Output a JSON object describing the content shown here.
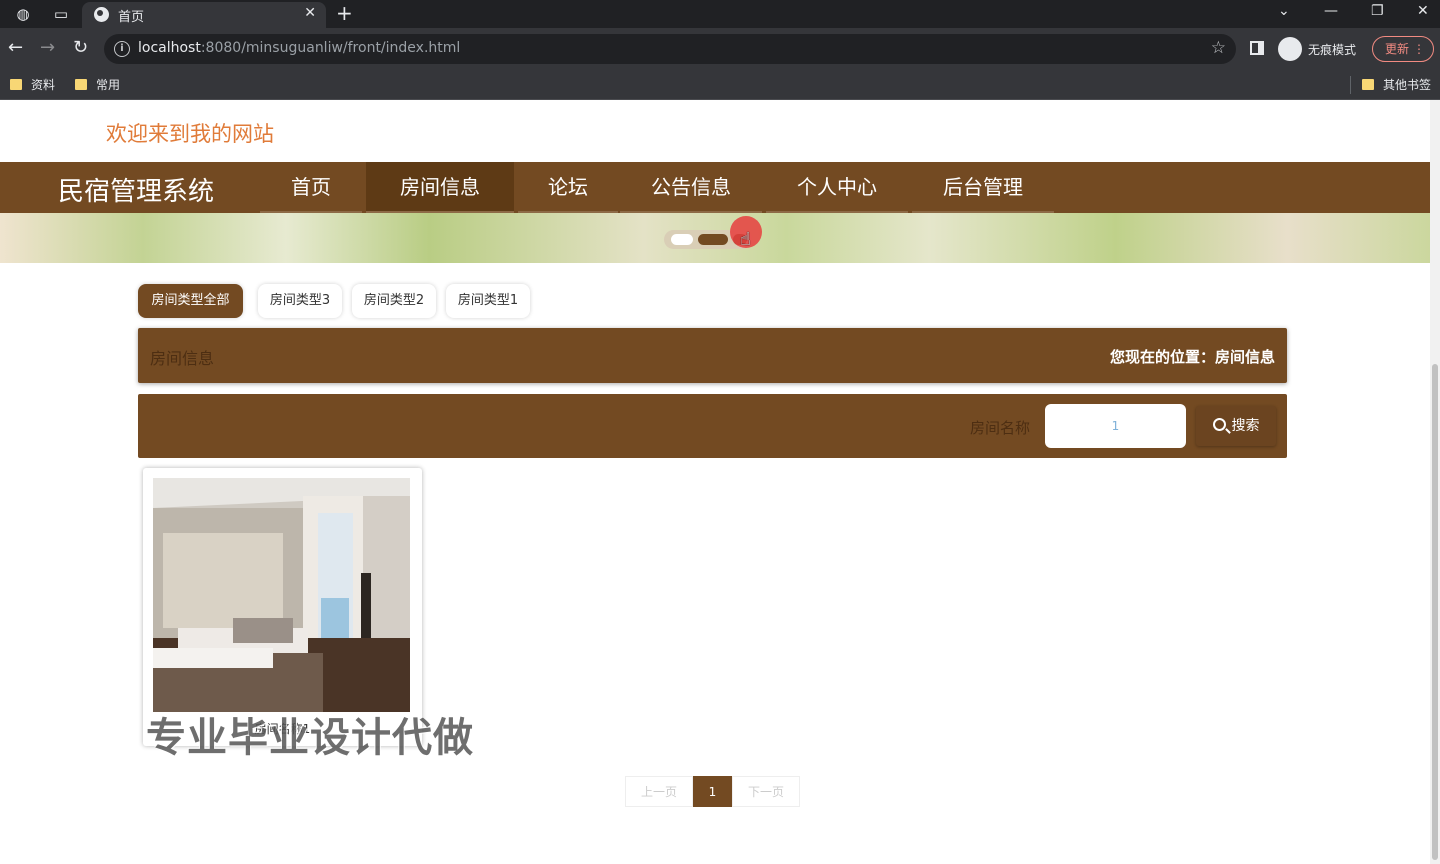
{
  "browser": {
    "tab_title": "首页",
    "url_host": "localhost",
    "url_path": ":8080/minsuguanliw/front/index.html",
    "incognito_label": "无痕模式",
    "update_label": "更新",
    "bookmarks": [
      "资料",
      "常用"
    ],
    "other_bookmarks": "其他书签"
  },
  "site": {
    "welcome": "欢迎来到我的网站",
    "brand": "民宿管理系统",
    "nav": [
      "首页",
      "房间信息",
      "论坛",
      "公告信息",
      "个人中心",
      "后台管理"
    ],
    "active_nav": "房间信息"
  },
  "filters": [
    "房间类型全部",
    "房间类型3",
    "房间类型2",
    "房间类型1"
  ],
  "title_bar": {
    "left": "房间信息",
    "location_prefix": "您现在的位置：",
    "location": "房间信息"
  },
  "search": {
    "label": "房间名称",
    "value": "1",
    "button": "搜索"
  },
  "rooms": [
    {
      "name": "房间名称1"
    }
  ],
  "watermark": "专业毕业设计代做",
  "pagination": {
    "prev": "上一页",
    "current": "1",
    "next": "下一页"
  },
  "colors": {
    "primary": "#734a22",
    "active": "#5e3a15",
    "welcome": "#e07b39"
  }
}
